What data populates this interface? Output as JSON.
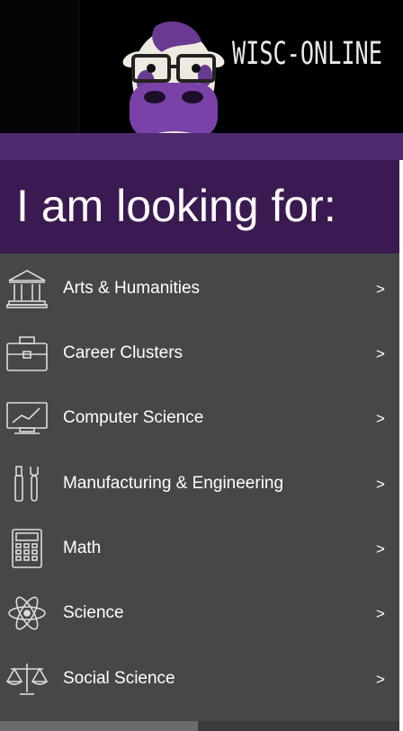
{
  "header": {
    "logo_text": "WISC-ONLINE"
  },
  "headline": "I am looking for:",
  "menu": {
    "chevron": ">",
    "items": [
      {
        "label": "Arts & Humanities",
        "icon": "building-columns-icon"
      },
      {
        "label": "Career Clusters",
        "icon": "briefcase-icon"
      },
      {
        "label": "Computer Science",
        "icon": "monitor-chart-icon"
      },
      {
        "label": "Manufacturing & Engineering",
        "icon": "tools-icon"
      },
      {
        "label": "Math",
        "icon": "calculator-icon"
      },
      {
        "label": "Science",
        "icon": "atom-icon"
      },
      {
        "label": "Social Science",
        "icon": "scales-icon"
      }
    ]
  },
  "colors": {
    "header_bg": "#000000",
    "purple_bar": "#4e2a6e",
    "headline_bg": "#3a1a50",
    "menu_bg": "#474747",
    "text": "#ffffff"
  }
}
